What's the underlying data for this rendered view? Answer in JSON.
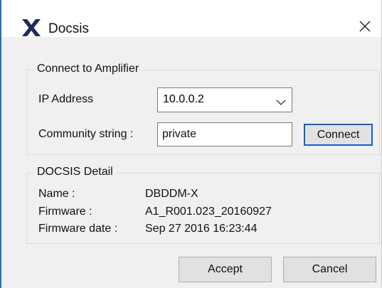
{
  "window": {
    "title": "Docsis",
    "accent_color": "#1e6fc8",
    "icon": "x-logo-icon",
    "close_icon": "close-icon"
  },
  "connect_group": {
    "title": "Connect to Amplifier",
    "ip_label": "IP Address",
    "ip_value": "10.0.0.2",
    "community_label": "Community string :",
    "community_value": "private",
    "connect_label": "Connect"
  },
  "detail_group": {
    "title": "DOCSIS Detail",
    "rows": [
      {
        "label": "Name :",
        "value": "DBDDM-X"
      },
      {
        "label": "Firmware :",
        "value": "A1_R001.023_20160927"
      },
      {
        "label": "Firmware date :",
        "value": "Sep 27 2016 16:23:44"
      }
    ]
  },
  "buttons": {
    "accept_label": "Accept",
    "cancel_label": "Cancel"
  }
}
